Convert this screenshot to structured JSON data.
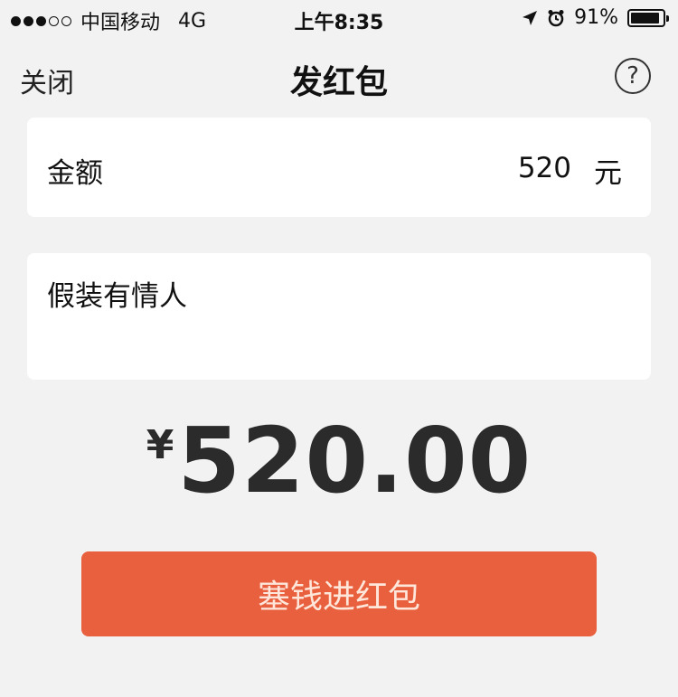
{
  "status_bar": {
    "carrier": "中国移动",
    "network": "4G",
    "time": "上午8:35",
    "battery_percent": "91%",
    "battery_level": 0.91,
    "icons": [
      "location-arrow-icon",
      "alarm-clock-icon",
      "battery-icon"
    ]
  },
  "nav": {
    "close_label": "关闭",
    "title": "发红包",
    "help_symbol": "?"
  },
  "amount": {
    "label": "金额",
    "value": "520",
    "unit": "元"
  },
  "message": {
    "text": "假装有情人"
  },
  "total": {
    "currency": "¥",
    "amount": "520.00"
  },
  "submit": {
    "label": "塞钱进红包"
  },
  "colors": {
    "background": "#f2f2f2",
    "button": "#e8603e",
    "button_text": "#ffe6da"
  }
}
